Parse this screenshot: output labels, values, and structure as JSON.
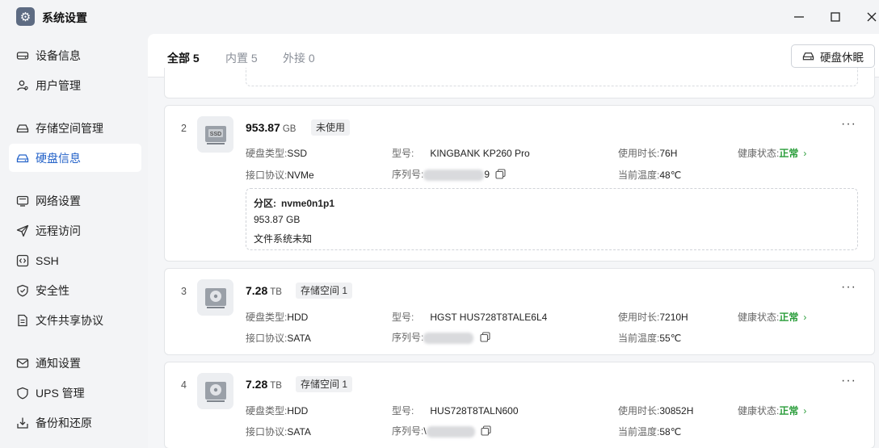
{
  "window": {
    "title": "系统设置"
  },
  "sidebar": {
    "items": [
      {
        "label": "设备信息",
        "icon": "drive-icon"
      },
      {
        "label": "用户管理",
        "icon": "users-icon"
      },
      {
        "label": "存储空间管理",
        "icon": "storage-icon"
      },
      {
        "label": "硬盘信息",
        "icon": "disk-icon",
        "active": true
      },
      {
        "label": "网络设置",
        "icon": "monitor-icon"
      },
      {
        "label": "远程访问",
        "icon": "send-icon"
      },
      {
        "label": "SSH",
        "icon": "terminal-icon"
      },
      {
        "label": "安全性",
        "icon": "shield-icon"
      },
      {
        "label": "文件共享协议",
        "icon": "file-icon"
      },
      {
        "label": "通知设置",
        "icon": "mail-icon"
      },
      {
        "label": "UPS 管理",
        "icon": "ups-shield-icon"
      },
      {
        "label": "备份和还原",
        "icon": "backup-icon"
      }
    ]
  },
  "tabs": [
    {
      "label": "全部",
      "count": "5",
      "active": true
    },
    {
      "label": "内置",
      "count": "5"
    },
    {
      "label": "外接",
      "count": "0"
    }
  ],
  "toolbar": {
    "sleep_label": "硬盘休眠"
  },
  "labels": {
    "disk_type": "硬盘类型:",
    "interface": "接口协议:",
    "model": "型号:",
    "serial": "序列号:",
    "uptime": "使用时长:",
    "temp": "当前温度:",
    "health": "健康状态:",
    "partition": "分区:"
  },
  "disks": [
    {
      "index": "2",
      "capacity": "953.87",
      "unit": "GB",
      "badge": "未使用",
      "icon_text": "SSD",
      "type": "SSD",
      "interface": "NVMe",
      "model": "KINGBANK KP260 Pro",
      "serial_tail": "9",
      "uptime": "76H",
      "temp": "48℃",
      "health": "正常",
      "partition": {
        "name": "nvme0n1p1",
        "size": "953.87 GB",
        "fs": "文件系统未知"
      }
    },
    {
      "index": "3",
      "capacity": "7.28",
      "unit": "TB",
      "badge": "存储空间 1",
      "type": "HDD",
      "interface": "SATA",
      "model": "HGST HUS728T8TALE6L4",
      "uptime": "7210H",
      "temp": "55℃",
      "health": "正常"
    },
    {
      "index": "4",
      "capacity": "7.28",
      "unit": "TB",
      "badge": "存储空间 1",
      "type": "HDD",
      "interface": "SATA",
      "model": "HUS728T8TALN600",
      "serial_head": "\\",
      "uptime": "30852H",
      "temp": "58℃",
      "health": "正常"
    }
  ]
}
